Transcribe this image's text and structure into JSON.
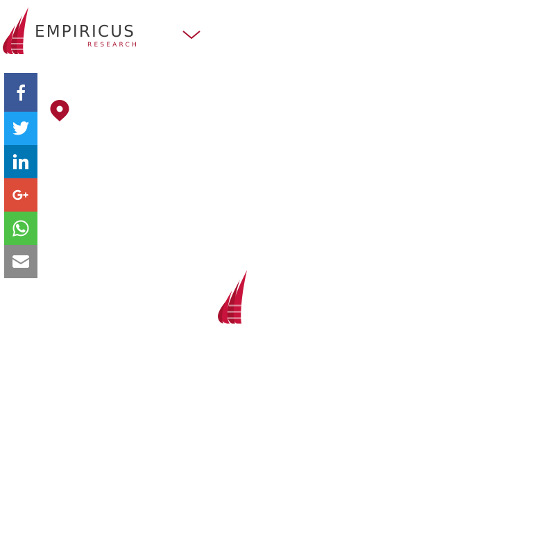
{
  "brand": {
    "name": "EMPIRICUS",
    "sub": "RESEARCH",
    "color": "#a8102e",
    "text_color": "#3b3b3b"
  },
  "header": {
    "menu_icon": "chevron-down-icon"
  },
  "share": {
    "items": [
      {
        "network": "facebook",
        "icon": "facebook-icon",
        "color": "#3b5998"
      },
      {
        "network": "twitter",
        "icon": "twitter-icon",
        "color": "#1da1f2"
      },
      {
        "network": "linkedin",
        "icon": "linkedin-icon",
        "color": "#0077b5"
      },
      {
        "network": "googleplus",
        "icon": "google-plus-icon",
        "color": "#dd4b39"
      },
      {
        "network": "whatsapp",
        "icon": "whatsapp-icon",
        "color": "#4dc247"
      },
      {
        "network": "email",
        "icon": "envelope-icon",
        "color": "#8a8a8a"
      }
    ]
  },
  "location": {
    "icon": "map-pin-icon",
    "color": "#a8102e"
  },
  "loader": {
    "icon": "empiricus-mark-icon",
    "color": "#a8102e"
  }
}
